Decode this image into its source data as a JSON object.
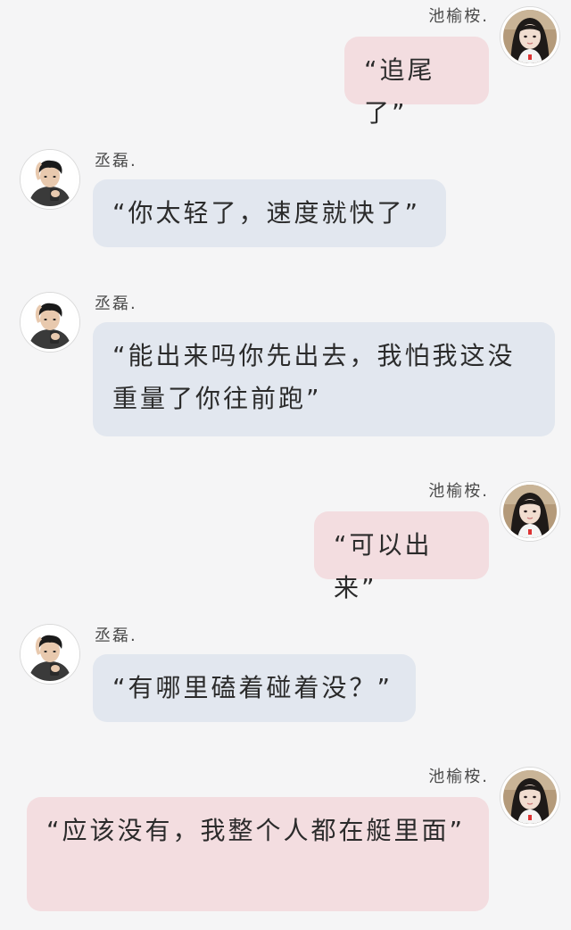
{
  "conversation": {
    "messages": [
      {
        "sender": "池榆桉.",
        "side": "right",
        "avatar_icon": "avatar-girl-icon",
        "text": "“追尾了”"
      },
      {
        "sender": "丞磊.",
        "side": "left",
        "avatar_icon": "avatar-boy-icon",
        "text": "“你太轻了，速度就快了”"
      },
      {
        "sender": "丞磊.",
        "side": "left",
        "avatar_icon": "avatar-boy-icon",
        "text": "“能出来吗你先出去，我怕我这没重量了你往前跑”"
      },
      {
        "sender": "池榆桉.",
        "side": "right",
        "avatar_icon": "avatar-girl-icon",
        "text": "“可以出来”"
      },
      {
        "sender": "丞磊.",
        "side": "left",
        "avatar_icon": "avatar-boy-icon",
        "text": "“有哪里磕着碰着没？”"
      },
      {
        "sender": "池榆桉.",
        "side": "right",
        "avatar_icon": "avatar-girl-icon",
        "text": "“应该没有，我整个人都在艇里面”"
      }
    ]
  },
  "colors": {
    "background": "#f5f5f6",
    "left_bubble": "#e2e7ef",
    "right_bubble": "#f3dde0",
    "text": "#2b2b2b",
    "name": "#4a4a4a"
  }
}
